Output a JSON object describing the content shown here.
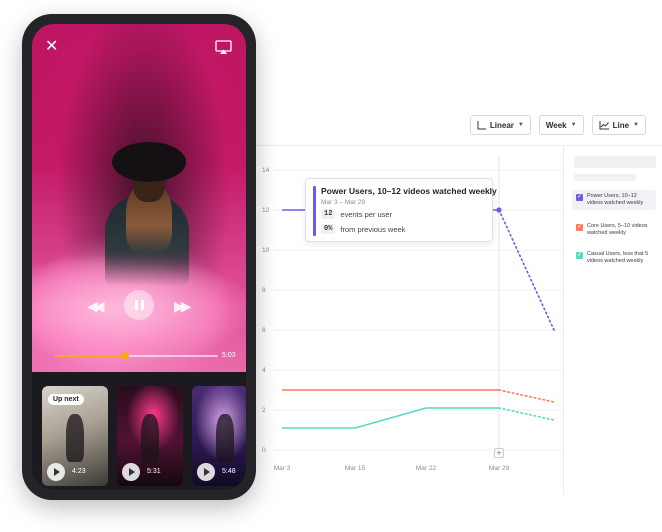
{
  "toolbar": {
    "scale_label": "Linear",
    "interval_label": "Week",
    "chart_type_label": "Line"
  },
  "tooltip": {
    "title": "Power Users, 10–12 videos watched weekly",
    "date_range": "Mar 3 – Mar 29",
    "metric_value": "12",
    "metric_label": "events per user",
    "change_value": "0%",
    "change_label": "from previous week"
  },
  "legend": [
    {
      "label": "Power Users, 10–12 videos watched weekly",
      "color": "#6c5ce7",
      "checked": true
    },
    {
      "label": "Core Users, 5–10 videos watched weekly",
      "color": "#ff7a59",
      "checked": true
    },
    {
      "label": "Casual Users, less that 5 videos watched weekly",
      "color": "#5ad8c4",
      "checked": true
    }
  ],
  "chart_data": {
    "type": "line",
    "x": [
      "Mar 3",
      "Mar 15",
      "Mar 22",
      "Mar 29"
    ],
    "y_ticks": [
      0,
      2,
      4,
      6,
      8,
      10,
      12,
      14
    ],
    "ylim": [
      0,
      14
    ],
    "series": [
      {
        "name": "Power Users, 10–12 videos watched weekly",
        "color": "#6c5ce7",
        "values": [
          12,
          12,
          12,
          12
        ],
        "projection": 6
      },
      {
        "name": "Core Users, 5–10 videos watched weekly",
        "color": "#ff7a59",
        "values": [
          3,
          3,
          3,
          3
        ],
        "projection": 2.4
      },
      {
        "name": "Casual Users, less that 5 videos watched weekly",
        "color": "#5ad8c4",
        "values": [
          1.1,
          1.1,
          2.1,
          2.1
        ],
        "projection": 1.5
      }
    ],
    "grid": true,
    "legend_position": "right"
  },
  "player": {
    "time_label": "5:03",
    "progress": 0.43
  },
  "up_next": {
    "badge": "Up next",
    "items": [
      {
        "duration": "4:23"
      },
      {
        "duration": "5:31"
      },
      {
        "duration": "5:48"
      }
    ]
  },
  "colors": {
    "accent": "#6c5ce7",
    "progress": "#f5a623"
  }
}
